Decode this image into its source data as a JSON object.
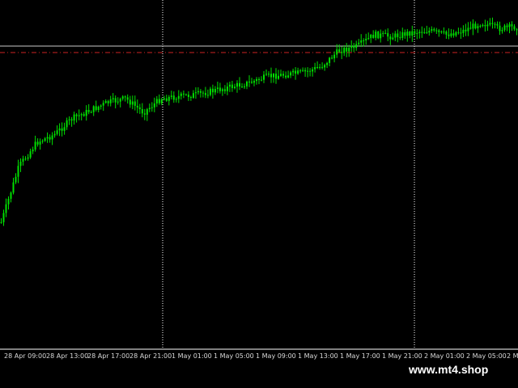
{
  "watermark": "www.mt4.shop",
  "colors": {
    "background": "#000000",
    "candle": "#00e000",
    "price_line": "#c8c8c8",
    "level_line": "#cc2222",
    "grid": "#ffffff",
    "axis_text": "#d8d8d8"
  },
  "time_axis": {
    "labels": [
      "28 Apr 09:00",
      "28 Apr 13:00",
      "28 Apr 17:00",
      "28 Apr 21:00",
      "1 May 01:00",
      "1 May 05:00",
      "1 May 09:00",
      "1 May 13:00",
      "1 May 17:00",
      "1 May 21:00",
      "2 May 01:00",
      "2 May 05:00",
      "2 M"
    ]
  },
  "chart_data": {
    "type": "candlestick",
    "x_labels": [
      "28 Apr 09:00",
      "28 Apr 13:00",
      "28 Apr 17:00",
      "28 Apr 21:00",
      "1 May 01:00",
      "1 May 05:00",
      "1 May 09:00",
      "1 May 13:00",
      "1 May 17:00",
      "1 May 21:00",
      "2 May 01:00",
      "2 May 05:00",
      "2 M"
    ],
    "trend": [
      0.0,
      0.28,
      0.4,
      0.44,
      0.52,
      0.56,
      0.6,
      0.62,
      0.55,
      0.62,
      0.63,
      0.64,
      0.66,
      0.68,
      0.7,
      0.73,
      0.74,
      0.75,
      0.78,
      0.86,
      0.88,
      0.94,
      0.93,
      0.95,
      0.96,
      0.94,
      0.96,
      1.0,
      0.97,
      0.98
    ],
    "grid": "vertical dotted at session breaks",
    "horizontal_lines": [
      "price line",
      "level line (dash-dot)"
    ]
  }
}
